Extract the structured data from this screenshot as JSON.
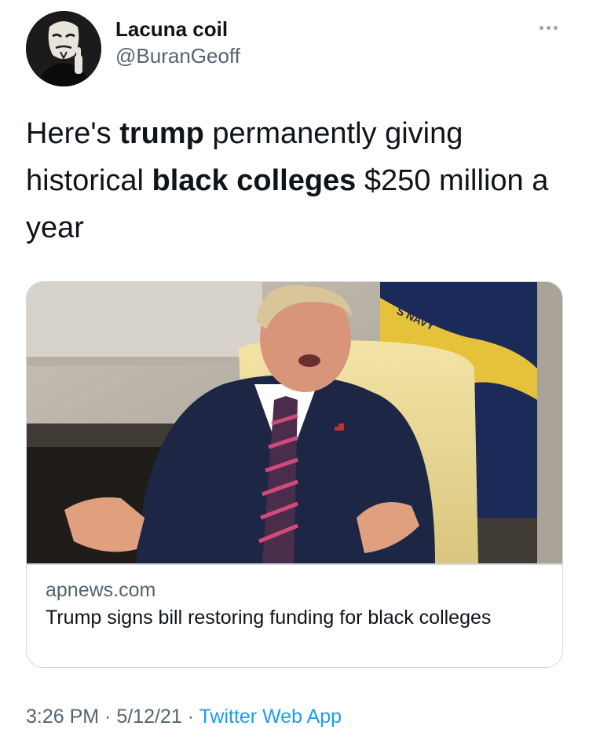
{
  "author": {
    "name": "Lacuna coil",
    "handle": "@BuranGeoff"
  },
  "tweet": {
    "segments": [
      {
        "text": "Here's ",
        "bold": false
      },
      {
        "text": "trump",
        "bold": true
      },
      {
        "text": " permanently giving historical ",
        "bold": false
      },
      {
        "text": "black colleges",
        "bold": true
      },
      {
        "text": " $250 million a year",
        "bold": false
      }
    ]
  },
  "card": {
    "domain": "apnews.com",
    "title": "Trump signs bill restoring funding for black colleges",
    "flag_text": "S NAVY"
  },
  "meta": {
    "time": "3:26 PM",
    "separator1": " · ",
    "date": "5/12/21",
    "separator2": " · ",
    "source": "Twitter Web App"
  },
  "icons": {
    "more": "more-horizontal-icon"
  },
  "colors": {
    "link": "#1d9bf0",
    "secondary_text": "#536471",
    "border": "#cfd9de"
  }
}
